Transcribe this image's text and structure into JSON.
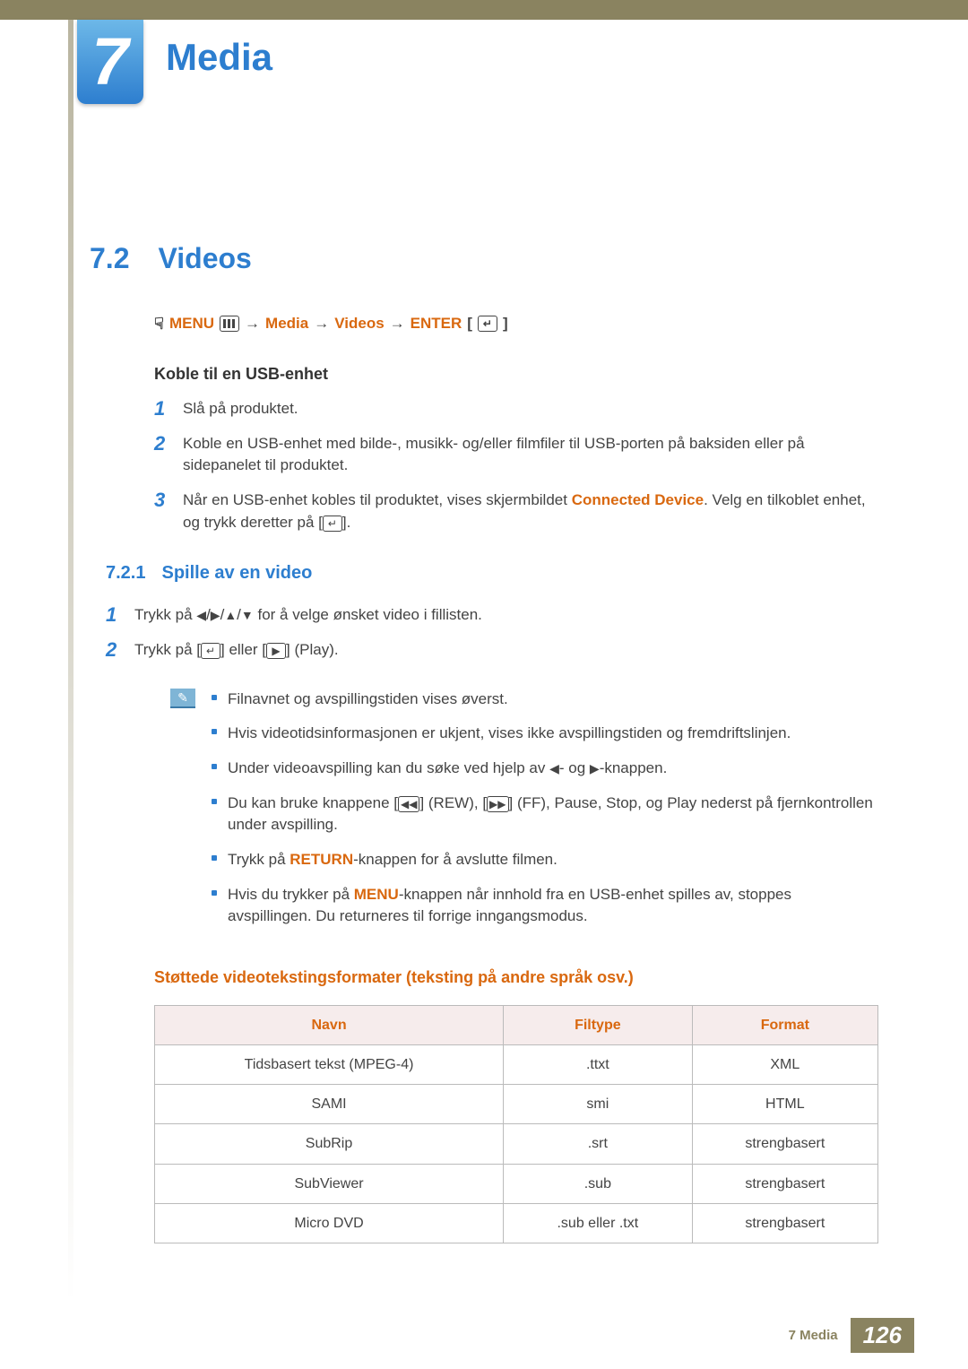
{
  "chapter": {
    "num": "7",
    "title": "Media"
  },
  "section": {
    "num": "7.2",
    "title": "Videos"
  },
  "nav": [
    "MENU",
    "Media",
    "Videos",
    "ENTER"
  ],
  "usb": {
    "heading": "Koble til en USB-enhet",
    "items": [
      {
        "n": "1",
        "text": "Slå på produktet."
      },
      {
        "n": "2",
        "text": "Koble en USB-enhet med bilde-, musikk- og/eller filmfiler til USB-porten på baksiden eller på sidepanelet til produktet."
      },
      {
        "n": "3",
        "pre": "Når en USB-enhet kobles til produktet, vises skjermbildet ",
        "hi": "Connected Device",
        "post": ". Velg en tilkoblet enhet, og trykk deretter på [",
        "post2": "]."
      }
    ]
  },
  "subsection": {
    "num": "7.2.1",
    "title": "Spille av en video"
  },
  "play": {
    "items": [
      {
        "n": "1",
        "pre": "Trykk på ",
        "post": " for å velge ønsket video i fillisten."
      },
      {
        "n": "2",
        "pre": "Trykk på [",
        "mid": "] eller [",
        "post": "] (Play)."
      }
    ]
  },
  "bullets": [
    "Filnavnet og avspillingstiden vises øverst.",
    "Hvis videotidsinformasjonen er ukjent, vises ikke avspillingstiden og fremdriftslinjen.",
    {
      "pre": "Under videoavspilling kan du søke ved hjelp av ",
      "post": "-knappen.",
      "mid": "- og "
    },
    {
      "pre": "Du kan bruke knappene [",
      "r1": "] (REW), [",
      "r2": "] (FF), Pause, Stop, og Play nederst på fjernkontrollen under avspilling."
    },
    {
      "pre": "Trykk på ",
      "hi": "RETURN",
      "post": "-knappen for å avslutte filmen."
    },
    {
      "pre": "Hvis du trykker på ",
      "hi": "MENU",
      "post": "-knappen når innhold fra en USB-enhet spilles av, stoppes avspillingen. Du returneres til forrige inngangsmodus."
    }
  ],
  "table": {
    "title": "Støttede videotekstingsformater (teksting på andre språk osv.)",
    "headers": [
      "Navn",
      "Filtype",
      "Format"
    ],
    "rows": [
      [
        "Tidsbasert tekst (MPEG-4)",
        ".ttxt",
        "XML"
      ],
      [
        "SAMI",
        "smi",
        "HTML"
      ],
      [
        "SubRip",
        ".srt",
        "strengbasert"
      ],
      [
        "SubViewer",
        ".sub",
        "strengbasert"
      ],
      [
        "Micro DVD",
        ".sub eller .txt",
        "strengbasert"
      ]
    ]
  },
  "footer": {
    "label": "7 Media",
    "page": "126"
  }
}
